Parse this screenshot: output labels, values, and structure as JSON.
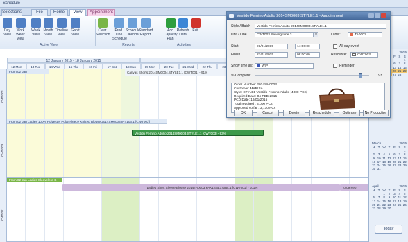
{
  "window": {
    "title": "Schedule"
  },
  "ribbon_tabs": [
    "Selections",
    "File",
    "Home",
    "View",
    "Appointment"
  ],
  "ribbon_buttons": [
    {
      "label": "Day View",
      "icon": "day-view-icon",
      "color": "#4f7fc4"
    },
    {
      "label": "Work Week View",
      "icon": "work-week-icon",
      "color": "#4f7fc4"
    },
    {
      "label": "Week View",
      "icon": "week-view-icon",
      "color": "#4f7fc4"
    },
    {
      "label": "Month View",
      "icon": "month-view-icon",
      "color": "#4f7fc4"
    },
    {
      "label": "Timeline View",
      "icon": "timeline-icon",
      "color": "#4f7fc4"
    },
    {
      "label": "Gantt View",
      "icon": "gantt-icon",
      "color": "#4f7fc4"
    },
    {
      "label": "Clear Selection",
      "icon": "clear-selection-icon",
      "color": "#7ab648"
    },
    {
      "label": "Prod. Line Schedule",
      "icon": "prod-line-icon",
      "color": "#6b9fd8"
    },
    {
      "label": "Schedule Calendar",
      "icon": "schedule-calendar-icon",
      "color": "#6b9fd8"
    },
    {
      "label": "Standard Report",
      "icon": "standard-report-icon",
      "color": "#6b9fd8"
    },
    {
      "label": "Add Capacity Plan",
      "icon": "add-capacity-icon",
      "color": "#2e9e3e"
    },
    {
      "label": "Refresh Data",
      "icon": "refresh-icon",
      "color": "#3c86d6"
    },
    {
      "label": "Exit",
      "icon": "exit-icon",
      "color": "#d0342c"
    }
  ],
  "ribbon_groups": [
    "Active View",
    "Reports",
    "Activities"
  ],
  "weeks": [
    "12 January 2015 - 18 January 2015",
    "19 January 2015 - 25 January 2015"
  ],
  "days": [
    "12 Mon",
    "13 Tue",
    "14 Wed",
    "15 Thu",
    "16 Fri",
    "17 Sat",
    "18 Sun",
    "19 Mon",
    "20 Tue",
    "21 Wed",
    "22 Thu",
    "23 Fri",
    "24 Sat",
    "25 Su"
  ],
  "lanes": [
    {
      "resource": "CWT001",
      "header": "From 02 Jan",
      "bar_text": "Canvas Shorts 2014SM0004.STYLE1.1 [CWT001] - 91%"
    },
    {
      "resource": "CWT003",
      "header": "From 02 Jan Ladies 100% Polyester Polar Fleece Knitted Blouse 2014SM0003.INT106.1 [CWT003]",
      "bar_text": "Vestido Femino Adulto 2014SM0003.STYLE1.1 [CWT003] - 93%"
    },
    {
      "resource": "CWT011",
      "header": "From 02 Jan Ladies Sleeveless B",
      "bar_text": "Ladies Short Sleeve Blouse 2014TA0003.FAK1SBL370BL.1 [CWT001] - 101%",
      "bar_end": "To 09 Feb"
    }
  ],
  "mini_calendars": [
    {
      "month": "February",
      "year": "2015",
      "weekdays": [
        "M",
        "T",
        "W",
        "T",
        "F",
        "S",
        "S"
      ],
      "days": [
        "",
        "",
        "",
        "",
        "",
        "",
        "1",
        "2",
        "3",
        "4",
        "5",
        "6",
        "7",
        "8",
        "9",
        "10",
        "11",
        "12",
        "13",
        "14",
        "15",
        "16",
        "17",
        "18",
        "19",
        "20",
        "21",
        "22",
        "23",
        "24",
        "25",
        "26",
        "27",
        "28",
        ""
      ]
    },
    {
      "month": "March",
      "year": "2015",
      "weekdays": [
        "M",
        "T",
        "W",
        "T",
        "F",
        "S",
        "S"
      ],
      "days": [
        "",
        "",
        "",
        "",
        "",
        "",
        "1",
        "2",
        "3",
        "4",
        "5",
        "6",
        "7",
        "8",
        "9",
        "10",
        "11",
        "12",
        "13",
        "14",
        "15",
        "16",
        "17",
        "18",
        "19",
        "20",
        "21",
        "22",
        "23",
        "24",
        "25",
        "26",
        "27",
        "28",
        "29",
        "30",
        "31"
      ]
    },
    {
      "month": "April",
      "year": "2015",
      "weekdays": [
        "M",
        "T",
        "W",
        "T",
        "F",
        "S",
        "S"
      ],
      "days": [
        "",
        "",
        "1",
        "2",
        "3",
        "4",
        "5",
        "6",
        "7",
        "8",
        "9",
        "10",
        "11",
        "12",
        "13",
        "14",
        "15",
        "16",
        "17",
        "18",
        "19",
        "20",
        "21",
        "22",
        "23",
        "24",
        "25",
        "26",
        "27",
        "28",
        "29",
        "30"
      ]
    }
  ],
  "today_label": "Today",
  "dialog": {
    "title": "Vestido Femino Adulto 2014SM0003.STYLE1.1 - Appointment",
    "style_batch_label": "Style / Batch",
    "style_batch_value": "Vestido Femino Adulto 2014SM0003.STYLE1.1",
    "unit_line_label": "Unit / Line",
    "unit_line_value": "CWT003 Sewing Line 3",
    "label_label": "Label:",
    "label_value": "TA0001",
    "label_color": "#e36a4a",
    "start_label": "Start",
    "start_date": "21/01/2015",
    "start_time": "14:00:00",
    "all_day_label": "All day event",
    "finish_label": "Finish",
    "finish_date": "27/01/2015",
    "finish_time": "08:00:00",
    "resource_label": "Resource:",
    "resource_value": "CWT003",
    "show_time_as_label": "Show time as:",
    "show_time_as_value": "WIP",
    "show_time_color": "#3a56b8",
    "reminder_label": "Reminder",
    "complete_label": "% Complete:",
    "complete_value": "93",
    "complete_fraction": 0.93,
    "notes": [
      "Order Number: 2014SM0003",
      "Customer: MARISA",
      "Style: STYLE1 Vestido Femino Adulto [4000 PCS]",
      "Required Date: 04-FEB-2015",
      "PCD Date:      19/01/2015",
      "",
      "Total required : 4,000 PCs",
      "Approved so far : 3,730 PCs"
    ],
    "buttons": [
      "OK",
      "Cancel",
      "Delete",
      "Reschedule",
      "Optimise",
      "No Production"
    ]
  }
}
